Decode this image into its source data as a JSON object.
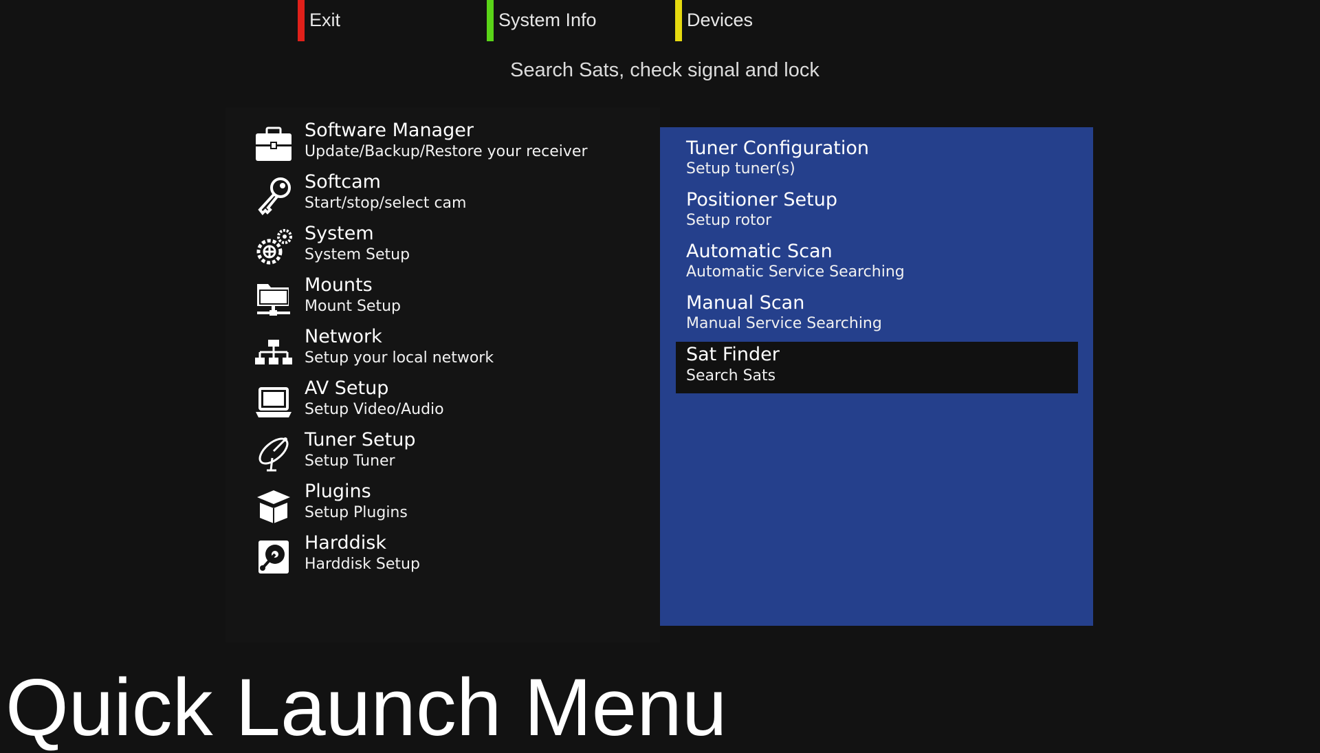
{
  "color_keys": [
    {
      "label": "Exit",
      "color": "#e0201a"
    },
    {
      "label": "System Info",
      "color": "#5ad418"
    },
    {
      "label": "Devices",
      "color": "#e6da10"
    }
  ],
  "hint_text": "Search Sats, check signal and lock",
  "main_menu": [
    {
      "icon": "toolbox-icon",
      "title": "Software Manager",
      "subtitle": "Update/Backup/Restore your receiver"
    },
    {
      "icon": "key-icon",
      "title": "Softcam",
      "subtitle": "Start/stop/select cam"
    },
    {
      "icon": "gears-icon",
      "title": "System",
      "subtitle": "System Setup"
    },
    {
      "icon": "network-mount-icon",
      "title": "Mounts",
      "subtitle": "Mount Setup"
    },
    {
      "icon": "network-icon",
      "title": "Network",
      "subtitle": "Setup your local network"
    },
    {
      "icon": "laptop-icon",
      "title": "AV Setup",
      "subtitle": "Setup Video/Audio"
    },
    {
      "icon": "satellite-dish-icon",
      "title": "Tuner Setup",
      "subtitle": "Setup Tuner"
    },
    {
      "icon": "open-box-icon",
      "title": "Plugins",
      "subtitle": "Setup Plugins"
    },
    {
      "icon": "harddisk-icon",
      "title": "Harddisk",
      "subtitle": "Harddisk Setup"
    }
  ],
  "sub_menu": [
    {
      "title": "Tuner Configuration",
      "subtitle": "Setup tuner(s)",
      "selected": false
    },
    {
      "title": "Positioner Setup",
      "subtitle": "Setup rotor",
      "selected": false
    },
    {
      "title": "Automatic Scan",
      "subtitle": "Automatic Service Searching",
      "selected": false
    },
    {
      "title": "Manual Scan",
      "subtitle": "Manual Service Searching",
      "selected": false
    },
    {
      "title": "Sat Finder",
      "subtitle": "Search Sats",
      "selected": true
    }
  ],
  "screen_title": "Quick Launch Menu",
  "colors": {
    "background": "#121212",
    "submenu_panel": "#25408c",
    "selection": "#111111"
  }
}
